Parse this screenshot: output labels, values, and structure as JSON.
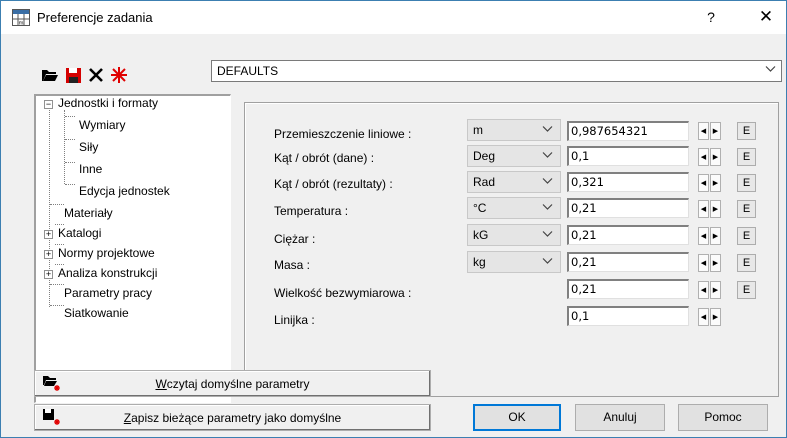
{
  "window": {
    "title": "Preferencje zadania",
    "help_label": "?",
    "close_label": "✕"
  },
  "toolbar": {
    "icons": [
      "open-folder-icon",
      "save-disk-icon",
      "delete-x-icon",
      "star-burst-icon"
    ]
  },
  "preset": {
    "selected": "DEFAULTS"
  },
  "tree": {
    "root": "Jednostki i formaty",
    "children": [
      "Wymiary",
      "Siły",
      "Inne",
      "Edycja jednostek"
    ],
    "items": [
      "Materiały",
      "Katalogi",
      "Normy projektowe",
      "Analiza konstrukcji",
      "Parametry pracy",
      "Siatkowanie"
    ]
  },
  "rows": [
    {
      "label": "Przemieszczenie liniowe :",
      "unit": "m",
      "value": "0,987654321",
      "has_unit": true,
      "has_e": true
    },
    {
      "label": "Kąt / obrót (dane) :",
      "unit": "Deg",
      "value": "0,1",
      "has_unit": true,
      "has_e": true
    },
    {
      "label": "Kąt / obrót (rezultaty) :",
      "unit": "Rad",
      "value": "0,321",
      "has_unit": true,
      "has_e": true
    },
    {
      "label": "Temperatura :",
      "unit": "°C",
      "value": "0,21",
      "has_unit": true,
      "has_e": true
    },
    {
      "label": "Ciężar :",
      "unit": "kG",
      "value": "0,21",
      "has_unit": true,
      "has_e": true
    },
    {
      "label": "Masa :",
      "unit": "kg",
      "value": "0,21",
      "has_unit": true,
      "has_e": true
    },
    {
      "label": "Wielkość bezwymiarowa :",
      "unit": "",
      "value": "0,21",
      "has_unit": false,
      "has_e": true
    },
    {
      "label": "Linijka :",
      "unit": "",
      "value": "0,1",
      "has_unit": false,
      "has_e": false
    }
  ],
  "e_label": "E",
  "buttons": {
    "load_prefix": "W",
    "load_rest": "czytaj domyślne parametry",
    "save_prefix": "Z",
    "save_rest": "apisz bieżące parametry jako domyślne",
    "ok": "OK",
    "cancel": "Anuluj",
    "help": "Pomoc"
  }
}
